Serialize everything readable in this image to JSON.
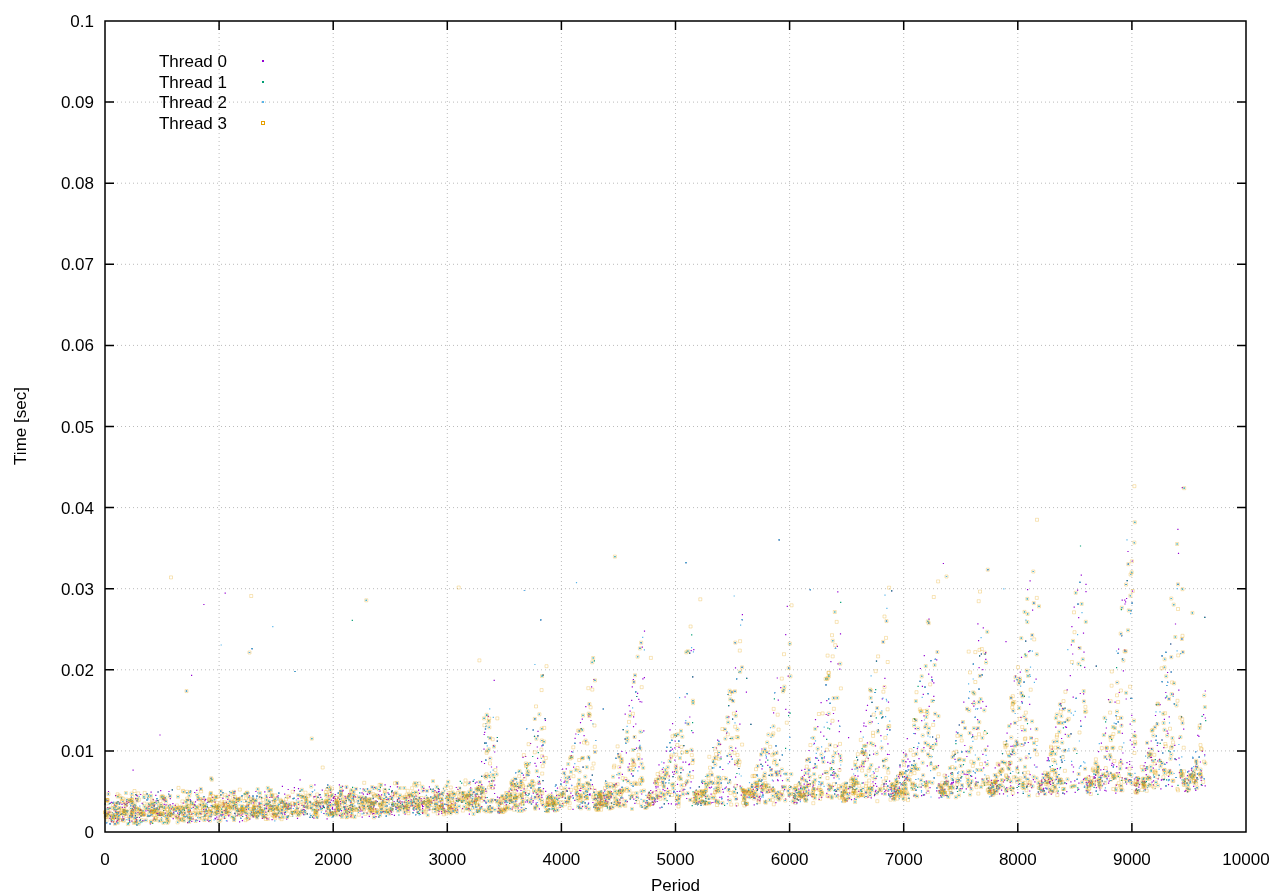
{
  "plot": {
    "x_axis_label": "Period",
    "y_axis_label": "Time [sec]",
    "x_tick_labels": [
      "0",
      "1000",
      "2000",
      "3000",
      "4000",
      "5000",
      "6000",
      "7000",
      "8000",
      "9000",
      "10000"
    ],
    "y_tick_labels": [
      "0.1",
      "0.09",
      "0.08",
      "0.07",
      "0.06",
      "0.05",
      "0.04",
      "0.03",
      "0.02",
      "0.01",
      "0"
    ],
    "legend": [
      {
        "label": "Thread 0",
        "color": "#9400d3",
        "kind": "dot"
      },
      {
        "label": "Thread 1",
        "color": "#009e73",
        "kind": "dot"
      },
      {
        "label": "Thread 2",
        "color": "#56b4e9",
        "kind": "dot"
      },
      {
        "label": "Thread 3",
        "color": "#e69f00",
        "kind": "square"
      }
    ]
  }
}
